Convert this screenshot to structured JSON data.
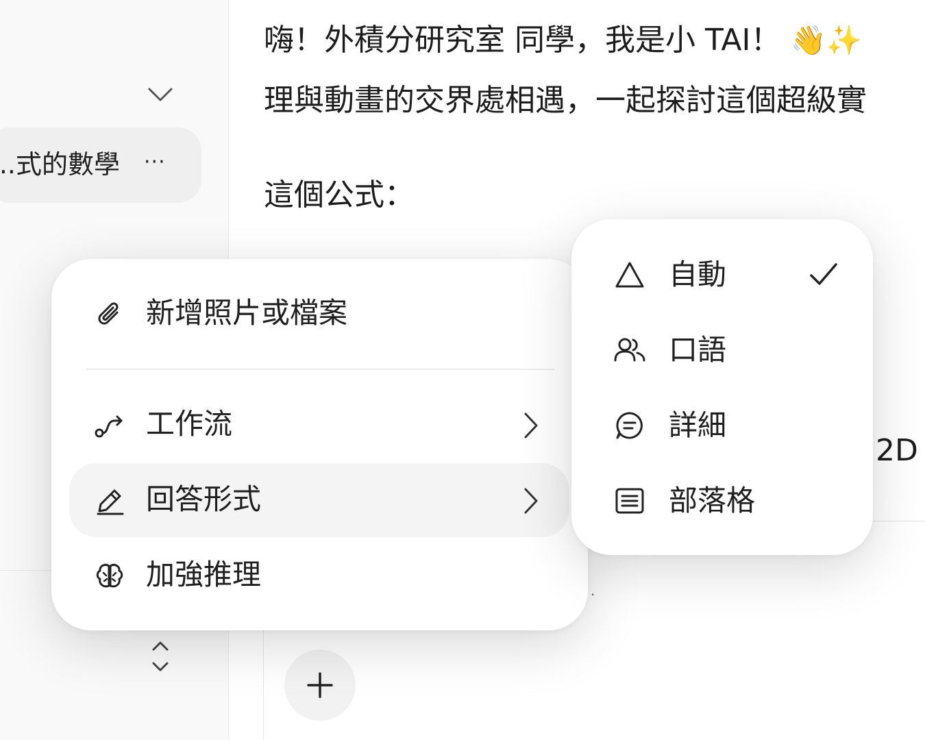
{
  "sidebar": {
    "conversation_title": "式的數學...",
    "more_label": "···"
  },
  "chat": {
    "line1": "嗨！外積分研究室 同學，我是小 TAI！",
    "line1_emoji": "👋✨",
    "line2": "理與動畫的交界處相遇，一起探討這個超級實",
    "line3": "這個公式：",
    "peek_right": "2D"
  },
  "menu": {
    "items": [
      {
        "label": "新增照片或檔案",
        "icon": "paperclip-icon"
      },
      {
        "label": "工作流",
        "icon": "workflow-icon",
        "has_submenu": true
      },
      {
        "label": "回答形式",
        "icon": "pencil-icon",
        "has_submenu": true,
        "active": true
      },
      {
        "label": "加強推理",
        "icon": "brain-icon"
      }
    ]
  },
  "submenu": {
    "items": [
      {
        "label": "自動",
        "icon": "triangle-icon",
        "selected": true
      },
      {
        "label": "口語",
        "icon": "people-icon"
      },
      {
        "label": "詳細",
        "icon": "chat-bubble-icon"
      },
      {
        "label": "部落格",
        "icon": "document-lines-icon"
      }
    ]
  },
  "colors": {
    "background": "#ffffff",
    "sidebar": "#f9f9f9",
    "active_item": "#f4f4f4",
    "text": "#1f1f1f"
  }
}
